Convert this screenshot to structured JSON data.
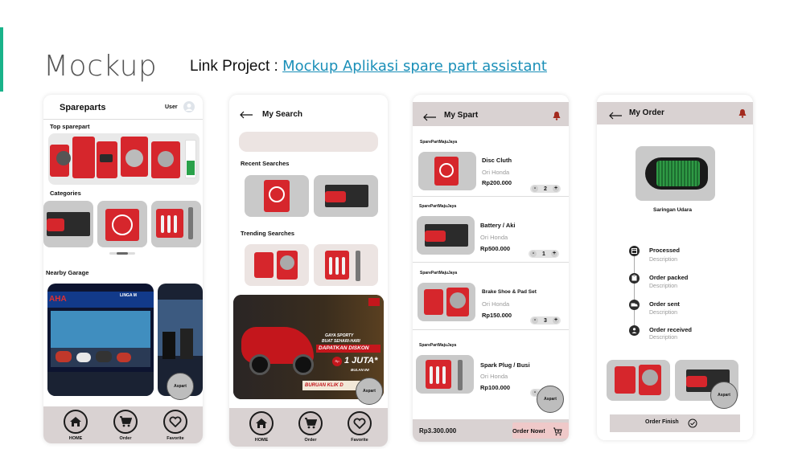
{
  "slide": {
    "title": "Mockup",
    "link_prefix": "Link Project : ",
    "link_text": "Mockup Aplikasi spare part assistant"
  },
  "screen_home": {
    "app_title": "Spareparts",
    "user_label": "User",
    "top_label": "Top sparepart",
    "categories_label": "Categories",
    "nearby_label": "Nearby Garage",
    "garage_sign": "AHA",
    "garage_sign2": "LINGA M",
    "assist_label": "Aspart",
    "nav": [
      {
        "label": "HOME",
        "icon": "home-icon"
      },
      {
        "label": "Order",
        "icon": "cart-icon"
      },
      {
        "label": "Favorite",
        "icon": "heart-icon"
      }
    ]
  },
  "screen_search": {
    "title": "My Search",
    "recent_label": "Recent Searches",
    "trending_label": "Trending Searches",
    "promo_line1": "GAYA SPORTY",
    "promo_line2": "BUAT SEHARI-HARI",
    "promo_line3": "DAPATKAN DISKON",
    "promo_amount": "1 JUTA*",
    "promo_line4": "BULAN INI",
    "promo_cta": "BURUAN KLIK D",
    "assist_label": "Aspart",
    "nav": [
      {
        "label": "HOME",
        "icon": "home-icon"
      },
      {
        "label": "Order",
        "icon": "cart-icon"
      },
      {
        "label": "Favorite",
        "icon": "heart-icon"
      }
    ]
  },
  "screen_cart": {
    "title": "My Spart",
    "items": [
      {
        "store": "SparePartMajuJaya",
        "name": "Disc Cluth",
        "brand": "Ori Honda",
        "price": "Rp200.000",
        "qty": "2"
      },
      {
        "store": "SparePartMajuJaya",
        "name": "Battery / Aki",
        "brand": "Ori Honda",
        "price": "Rp500.000",
        "qty": "1"
      },
      {
        "store": "SparePartMajuJaya",
        "name": "Brake Shoe & Pad Set",
        "brand": "Ori Honda",
        "price": "Rp150.000",
        "qty": "3"
      },
      {
        "store": "SparePartMajuJaya",
        "name": "Spark Plug / Busi",
        "brand": "Ori Honda",
        "price": "Rp100.000",
        "qty": ""
      }
    ],
    "total": "Rp3.300.000",
    "order_button": "Order Now!",
    "assist_label": "Aspart"
  },
  "screen_order": {
    "title": "My Order",
    "product_name": "Saringan Udara",
    "steps": [
      {
        "label": "Processed",
        "desc": "Description"
      },
      {
        "label": "Order packed",
        "desc": "Description"
      },
      {
        "label": "Order sent",
        "desc": "Description"
      },
      {
        "label": "Order received",
        "desc": "Description"
      }
    ],
    "finish_button": "Order Finish",
    "assist_label": "Aspart"
  },
  "colors": {
    "accent": "#19b38a",
    "link": "#1a8fb8",
    "header_bg": "#d9d2d2",
    "part_red": "#d6262c"
  }
}
